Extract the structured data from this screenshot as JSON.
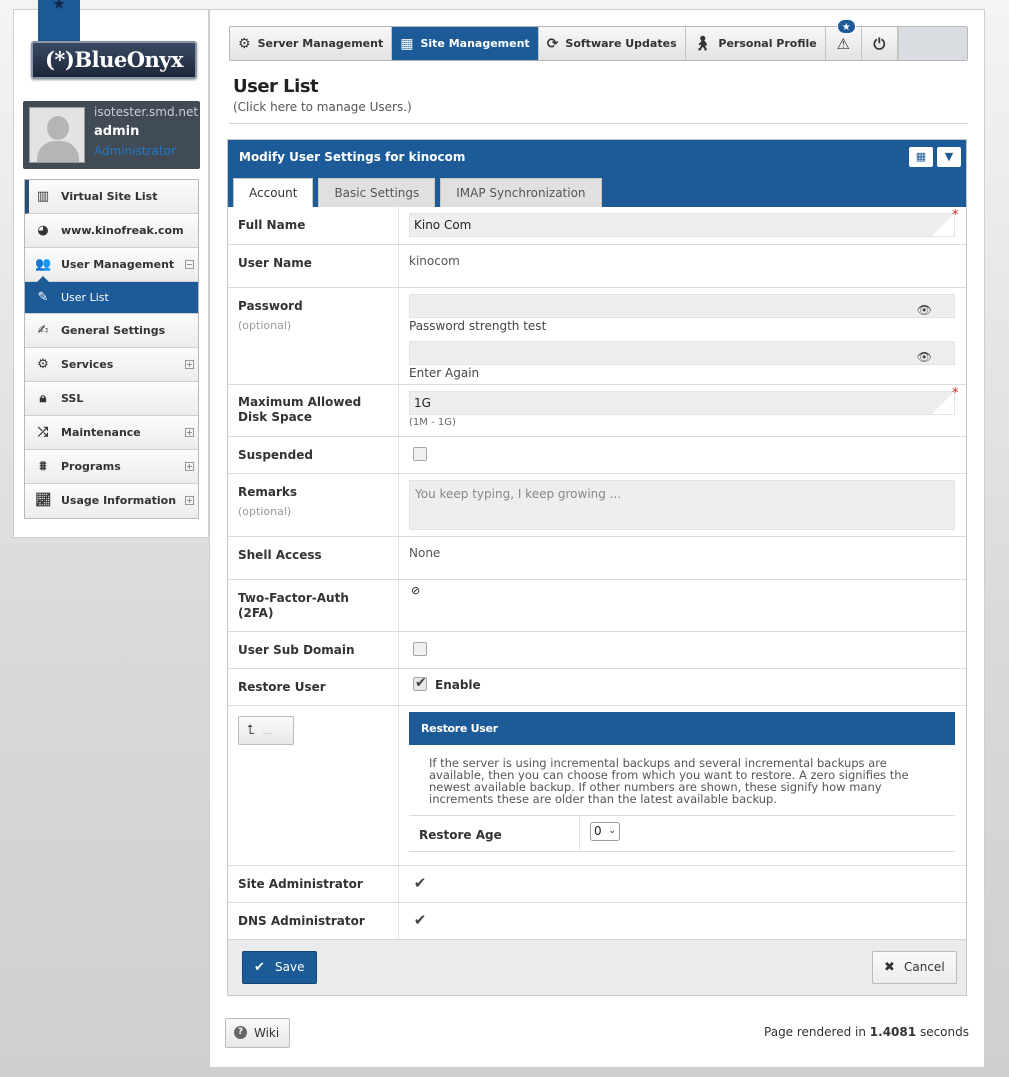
{
  "branding": {
    "logo_text": "(*)BlueOnyx"
  },
  "user_card": {
    "host": "isotester.smd.net",
    "username": "admin",
    "role": "Administrator"
  },
  "sidebar": {
    "items": [
      {
        "label": "Virtual Site List",
        "icon": "site-list-icon"
      },
      {
        "label": "www.kinofreak.com",
        "icon": "globe-icon"
      },
      {
        "label": "User Management",
        "icon": "users-icon",
        "expand": "−"
      },
      {
        "label": "User List",
        "icon": "pencil-icon"
      },
      {
        "label": "General Settings",
        "icon": "edit-icon"
      },
      {
        "label": "Services",
        "icon": "gear-icon",
        "expand": "+"
      },
      {
        "label": "SSL",
        "icon": "lock-icon"
      },
      {
        "label": "Maintenance",
        "icon": "shuffle-icon",
        "expand": "+"
      },
      {
        "label": "Programs",
        "icon": "chip-icon",
        "expand": "+"
      },
      {
        "label": "Usage Information",
        "icon": "chart-icon",
        "expand": "+"
      }
    ]
  },
  "topnav": {
    "tabs": [
      {
        "label": "Server Management",
        "icon": "gear-icon"
      },
      {
        "label": "Site Management",
        "icon": "grid-icon"
      },
      {
        "label": "Software Updates",
        "icon": "refresh-icon"
      },
      {
        "label": "Personal Profile",
        "icon": "user-icon"
      }
    ],
    "notification_badge": "★"
  },
  "page": {
    "title": "User List",
    "subtitle": "(Click here to manage Users.)"
  },
  "form": {
    "title": "Modify User Settings for kinocom",
    "tabs": [
      "Account",
      "Basic Settings",
      "IMAP Synchronization"
    ],
    "full_name": {
      "label": "Full Name",
      "value": "Kino Com"
    },
    "user_name": {
      "label": "User Name",
      "value": "kinocom"
    },
    "password": {
      "label": "Password",
      "optional": "(optional)",
      "strength_label": "Password strength test",
      "again_label": "Enter Again"
    },
    "disk_space": {
      "label1": "Maximum Allowed",
      "label2": "Disk Space",
      "value": "1G",
      "hint": "(1M - 1G)"
    },
    "suspended": {
      "label": "Suspended",
      "checked": false
    },
    "remarks": {
      "label": "Remarks",
      "optional": "(optional)",
      "placeholder": "You keep typing, I keep growing ..."
    },
    "shell_access": {
      "label": "Shell Access",
      "value": "None"
    },
    "two_factor": {
      "label1": "Two-Factor-Auth",
      "label2": "(2FA)",
      "value": "⊘"
    },
    "sub_domain": {
      "label": "User Sub Domain",
      "checked": false
    },
    "restore_user": {
      "label": "Restore User",
      "enable_label": "Enable",
      "checked": true
    },
    "restore_panel": {
      "button_dots": "...",
      "title": "Restore User",
      "description": "If the server is using incremental backups and several incremental backups are available, then you can choose from which you want to restore. A zero signifies the newest available backup. If other numbers are shown, these signify how many increments these are older than the latest available backup.",
      "age_label": "Restore Age",
      "age_value": "0"
    },
    "site_admin": {
      "label": "Site Administrator",
      "checked": true
    },
    "dns_admin": {
      "label": "DNS Administrator",
      "checked": true
    },
    "save_label": "Save",
    "cancel_label": "Cancel"
  },
  "footer": {
    "wiki_label": "Wiki",
    "render_prefix": "Page rendered in",
    "render_time": "1.4081",
    "render_suffix": "seconds"
  },
  "colors": {
    "accent": "#1d5a98",
    "required": "#c62828"
  }
}
